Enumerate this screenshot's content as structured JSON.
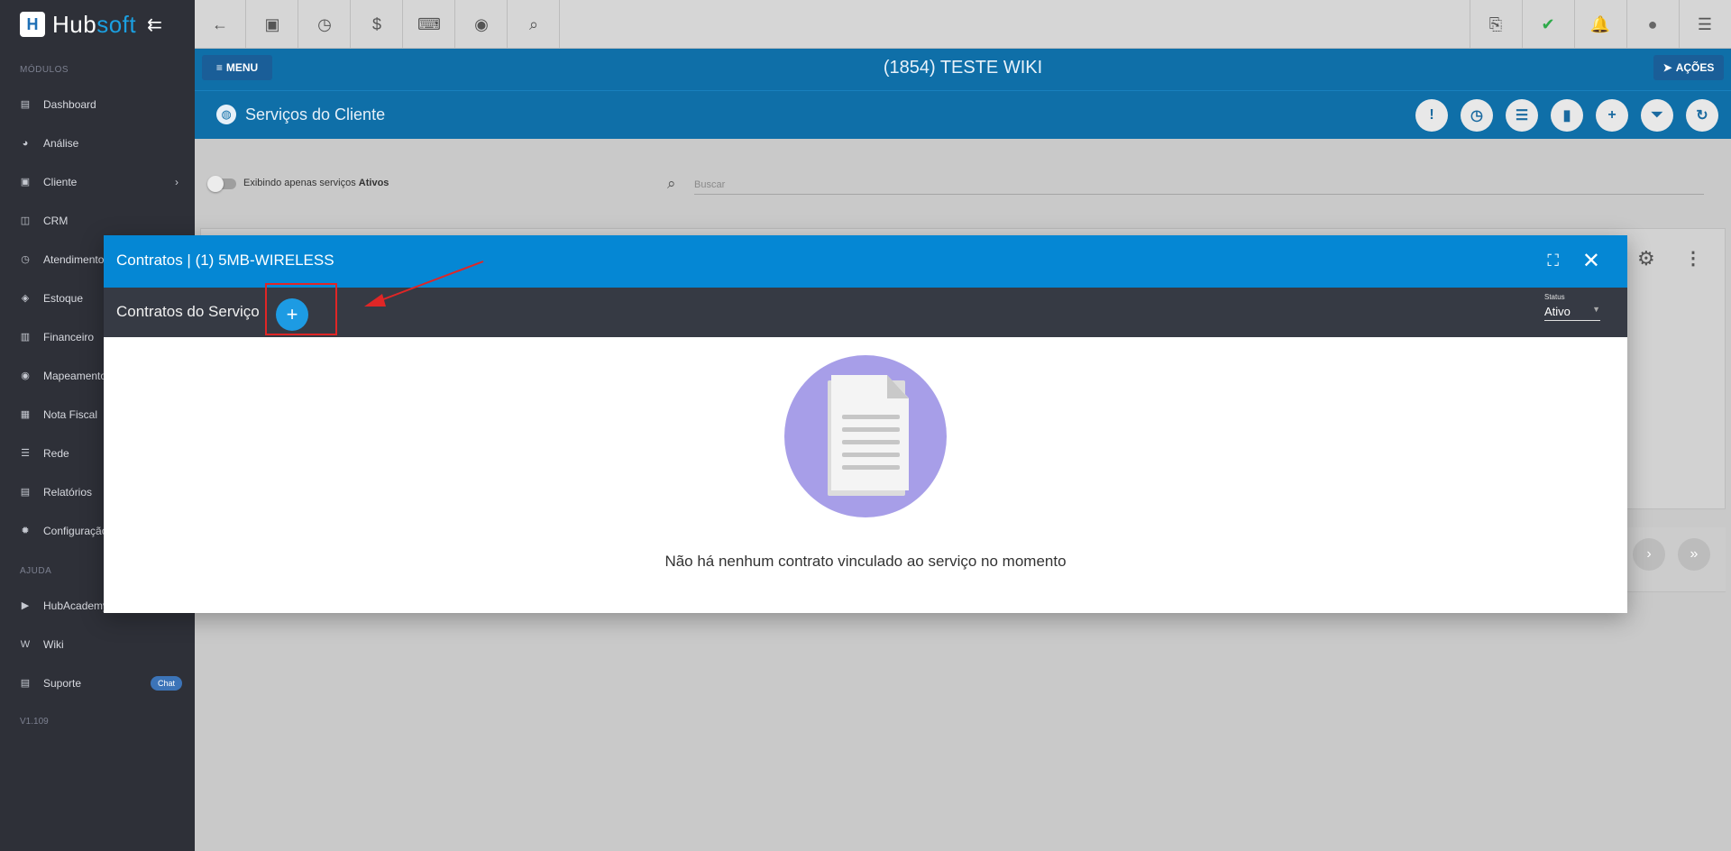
{
  "brand": {
    "name_part1": "Hub",
    "name_part2": "soft"
  },
  "sidebar": {
    "section_modules": "MÓDULOS",
    "items": [
      {
        "label": "Dashboard",
        "icon": "dashboard-icon"
      },
      {
        "label": "Análise",
        "icon": "pie-chart-icon"
      },
      {
        "label": "Cliente",
        "icon": "contact-card-icon"
      },
      {
        "label": "CRM",
        "icon": "crm-icon"
      },
      {
        "label": "Atendimento",
        "icon": "calendar-clock-icon"
      },
      {
        "label": "Estoque",
        "icon": "box-icon"
      },
      {
        "label": "Financeiro",
        "icon": "money-icon"
      },
      {
        "label": "Mapeamento",
        "icon": "map-pin-icon"
      },
      {
        "label": "Nota Fiscal",
        "icon": "receipt-icon"
      },
      {
        "label": "Rede",
        "icon": "server-icon"
      },
      {
        "label": "Relatórios",
        "icon": "report-icon"
      },
      {
        "label": "Configuração",
        "icon": "gear-icon"
      }
    ],
    "section_help": "AJUDA",
    "help_items": [
      {
        "label": "HubAcademy",
        "icon": "youtube-icon"
      },
      {
        "label": "Wiki",
        "icon": "wiki-icon"
      },
      {
        "label": "Suporte",
        "icon": "support-icon",
        "badge": "Chat"
      }
    ],
    "version": "V1.109"
  },
  "client_header": {
    "menu_label": "MENU",
    "title": "(1854) TESTE WIKI",
    "acoes_label": "AÇÕES",
    "section_title": "Serviços do Cliente"
  },
  "filters": {
    "toggle_text": "Exibindo apenas serviços ",
    "toggle_bold": "Ativos",
    "search_placeholder": "Buscar"
  },
  "modal": {
    "title": "Contratos | (1) 5MB-WIRELESS",
    "subtitle": "Contratos do Serviço",
    "status_label": "Status",
    "status_value": "Ativo",
    "empty_message": "Não há nenhum contrato vinculado ao serviço no momento"
  },
  "colors": {
    "sidebar_bg": "#2e3038",
    "header_blue": "#0f6fa8",
    "modal_header": "#0587d4",
    "modal_sub": "#363a44",
    "accent_add": "#1d9be3",
    "annotation_red": "#e02626",
    "illustration_purple": "#a79ee8"
  }
}
